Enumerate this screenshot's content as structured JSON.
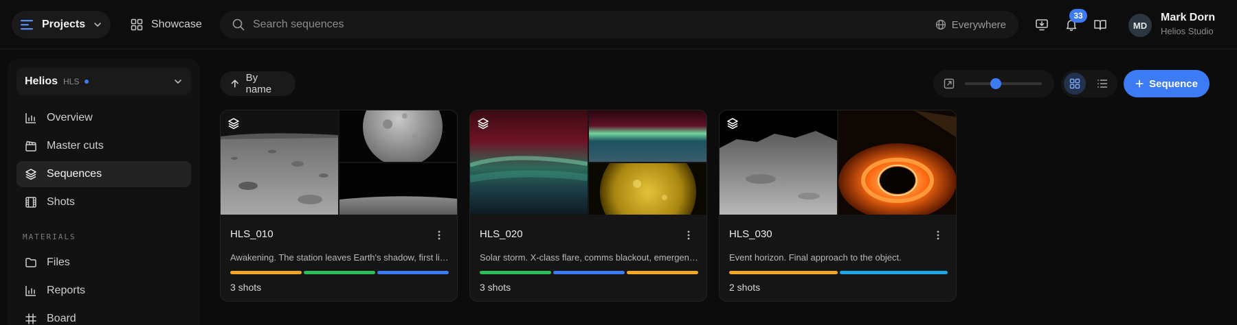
{
  "topbar": {
    "projects_label": "Projects",
    "showcase_label": "Showcase",
    "search_placeholder": "Search sequences",
    "search_scope": "Everywhere",
    "notifications_count": "33",
    "user": {
      "name": "Mark Dorn",
      "org": "Helios Studio",
      "initials": "MD"
    }
  },
  "sidebar": {
    "project": {
      "name": "Helios",
      "code": "HLS"
    },
    "nav": [
      {
        "label": "Overview",
        "icon": "bar-chart-icon"
      },
      {
        "label": "Master cuts",
        "icon": "clapperboard-icon"
      },
      {
        "label": "Sequences",
        "icon": "layers-icon",
        "active": true
      },
      {
        "label": "Shots",
        "icon": "film-icon"
      }
    ],
    "section_materials": "MATERIALS",
    "materials": [
      {
        "label": "Files",
        "icon": "folder-icon"
      },
      {
        "label": "Reports",
        "icon": "bar-chart-icon"
      },
      {
        "label": "Board",
        "icon": "hash-icon"
      }
    ]
  },
  "toolbar": {
    "sort_label": "By name",
    "zoom_level": 0.4,
    "view_mode": "grid",
    "new_sequence_label": "Sequence"
  },
  "colors": {
    "accent": "#3d7bf5",
    "status_orange": "#f2a623",
    "status_green": "#2fbf5a",
    "status_blue": "#3d7bf5",
    "status_cyan": "#1ea4e0"
  },
  "cards": [
    {
      "title": "HLS_010",
      "description": "Awakening. The station leaves Earth's shadow, first light on the hull.",
      "status_colors": [
        "#f2a623",
        "#2fbf5a",
        "#3d7bf5"
      ],
      "count_label": "3 shots"
    },
    {
      "title": "HLS_020",
      "description": "Solar storm. X-class flare, comms blackout, emergency protocol.",
      "status_colors": [
        "#2fbf5a",
        "#3d7bf5",
        "#f2a623"
      ],
      "count_label": "3 shots"
    },
    {
      "title": "HLS_030",
      "description": "Event horizon. Final approach to the object.",
      "status_colors": [
        "#f2a623",
        "#1ea4e0"
      ],
      "count_label": "2 shots"
    }
  ]
}
